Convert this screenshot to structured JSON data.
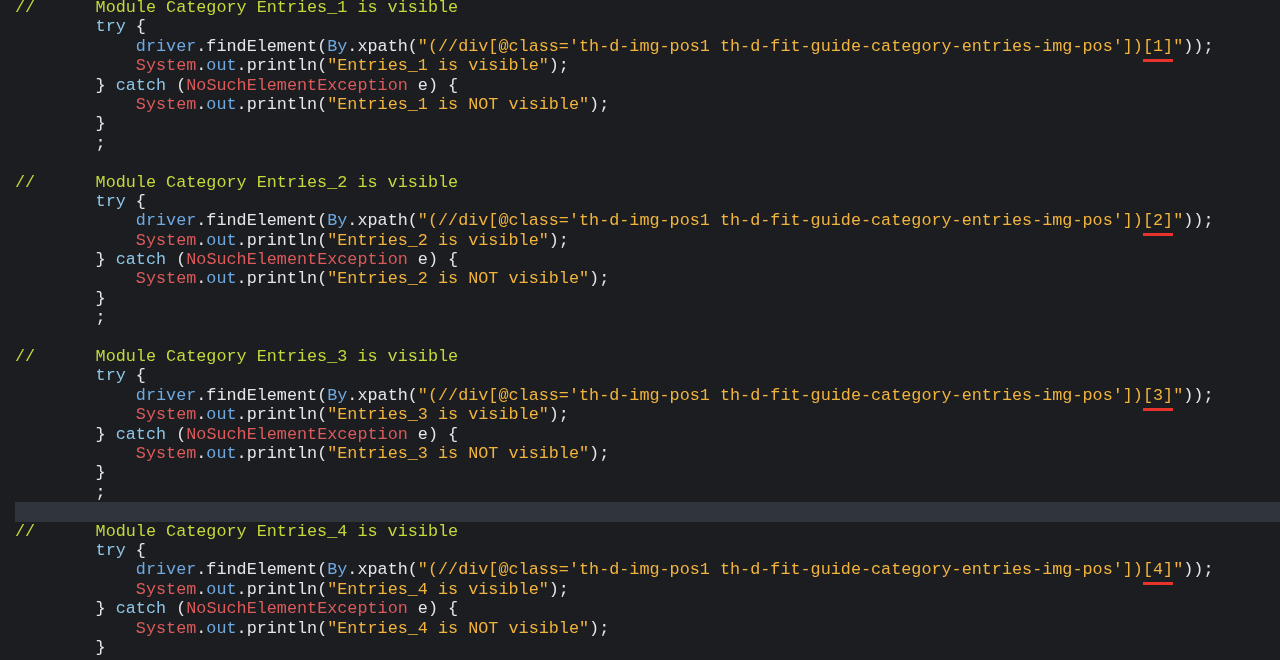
{
  "editor": {
    "lines": [
      {
        "kind": "code",
        "tokens": [
          {
            "kind": "comment",
            "text": "//      Module Category Entries_1 is visible"
          }
        ]
      },
      {
        "kind": "code",
        "tokens": [
          {
            "kind": "keyword",
            "text": "        try"
          },
          {
            "kind": "plain",
            "text": " {"
          }
        ]
      },
      {
        "kind": "code",
        "tokens": [
          {
            "kind": "variable",
            "text": "            driver"
          },
          {
            "kind": "plain",
            "text": ".findElement("
          },
          {
            "kind": "variable",
            "text": "By"
          },
          {
            "kind": "plain",
            "text": ".xpath("
          },
          {
            "kind": "string",
            "text": "\"(//div[@class='th-d-img-pos1 th-d-fit-guide-category-entries-img-pos'])"
          },
          {
            "kind": "underlined_string",
            "text": "[1]"
          },
          {
            "kind": "string",
            "text": "\""
          },
          {
            "kind": "plain",
            "text": "));"
          }
        ]
      },
      {
        "kind": "code",
        "tokens": [
          {
            "kind": "type",
            "text": "            System"
          },
          {
            "kind": "plain",
            "text": "."
          },
          {
            "kind": "variable",
            "text": "out"
          },
          {
            "kind": "plain",
            "text": ".println("
          },
          {
            "kind": "string",
            "text": "\"Entries_1 is visible\""
          },
          {
            "kind": "plain",
            "text": ");"
          }
        ]
      },
      {
        "kind": "code",
        "tokens": [
          {
            "kind": "plain",
            "text": "        } "
          },
          {
            "kind": "keyword",
            "text": "catch"
          },
          {
            "kind": "plain",
            "text": " ("
          },
          {
            "kind": "type",
            "text": "NoSuchElementException"
          },
          {
            "kind": "plain",
            "text": " e) {"
          }
        ]
      },
      {
        "kind": "code",
        "tokens": [
          {
            "kind": "type",
            "text": "            System"
          },
          {
            "kind": "plain",
            "text": "."
          },
          {
            "kind": "variable",
            "text": "out"
          },
          {
            "kind": "plain",
            "text": ".println("
          },
          {
            "kind": "string",
            "text": "\"Entries_1 is NOT visible\""
          },
          {
            "kind": "plain",
            "text": ");"
          }
        ]
      },
      {
        "kind": "code",
        "tokens": [
          {
            "kind": "plain",
            "text": "        }"
          }
        ]
      },
      {
        "kind": "code",
        "tokens": [
          {
            "kind": "plain",
            "text": "        ;"
          }
        ]
      },
      {
        "kind": "blank"
      },
      {
        "kind": "code",
        "tokens": [
          {
            "kind": "comment",
            "text": "//      Module Category Entries_2 is visible"
          }
        ]
      },
      {
        "kind": "code",
        "tokens": [
          {
            "kind": "keyword",
            "text": "        try"
          },
          {
            "kind": "plain",
            "text": " {"
          }
        ]
      },
      {
        "kind": "code",
        "tokens": [
          {
            "kind": "variable",
            "text": "            driver"
          },
          {
            "kind": "plain",
            "text": ".findElement("
          },
          {
            "kind": "variable",
            "text": "By"
          },
          {
            "kind": "plain",
            "text": ".xpath("
          },
          {
            "kind": "string",
            "text": "\"(//div[@class='th-d-img-pos1 th-d-fit-guide-category-entries-img-pos'])"
          },
          {
            "kind": "underlined_string",
            "text": "[2]"
          },
          {
            "kind": "string",
            "text": "\""
          },
          {
            "kind": "plain",
            "text": "));"
          }
        ]
      },
      {
        "kind": "code",
        "tokens": [
          {
            "kind": "type",
            "text": "            System"
          },
          {
            "kind": "plain",
            "text": "."
          },
          {
            "kind": "variable",
            "text": "out"
          },
          {
            "kind": "plain",
            "text": ".println("
          },
          {
            "kind": "string",
            "text": "\"Entries_2 is visible\""
          },
          {
            "kind": "plain",
            "text": ");"
          }
        ]
      },
      {
        "kind": "code",
        "tokens": [
          {
            "kind": "plain",
            "text": "        } "
          },
          {
            "kind": "keyword",
            "text": "catch"
          },
          {
            "kind": "plain",
            "text": " ("
          },
          {
            "kind": "type",
            "text": "NoSuchElementException"
          },
          {
            "kind": "plain",
            "text": " e) {"
          }
        ]
      },
      {
        "kind": "code",
        "tokens": [
          {
            "kind": "type",
            "text": "            System"
          },
          {
            "kind": "plain",
            "text": "."
          },
          {
            "kind": "variable",
            "text": "out"
          },
          {
            "kind": "plain",
            "text": ".println("
          },
          {
            "kind": "string",
            "text": "\"Entries_2 is NOT visible\""
          },
          {
            "kind": "plain",
            "text": ");"
          }
        ]
      },
      {
        "kind": "code",
        "tokens": [
          {
            "kind": "plain",
            "text": "        }"
          }
        ]
      },
      {
        "kind": "code",
        "tokens": [
          {
            "kind": "plain",
            "text": "        ;"
          }
        ]
      },
      {
        "kind": "blank"
      },
      {
        "kind": "code",
        "tokens": [
          {
            "kind": "comment",
            "text": "//      Module Category Entries_3 is visible"
          }
        ]
      },
      {
        "kind": "code",
        "tokens": [
          {
            "kind": "keyword",
            "text": "        try"
          },
          {
            "kind": "plain",
            "text": " {"
          }
        ]
      },
      {
        "kind": "code",
        "tokens": [
          {
            "kind": "variable",
            "text": "            driver"
          },
          {
            "kind": "plain",
            "text": ".findElement("
          },
          {
            "kind": "variable",
            "text": "By"
          },
          {
            "kind": "plain",
            "text": ".xpath("
          },
          {
            "kind": "string",
            "text": "\"(//div[@class='th-d-img-pos1 th-d-fit-guide-category-entries-img-pos'])"
          },
          {
            "kind": "underlined_string",
            "text": "[3]"
          },
          {
            "kind": "string",
            "text": "\""
          },
          {
            "kind": "plain",
            "text": "));"
          }
        ]
      },
      {
        "kind": "code",
        "tokens": [
          {
            "kind": "type",
            "text": "            System"
          },
          {
            "kind": "plain",
            "text": "."
          },
          {
            "kind": "variable",
            "text": "out"
          },
          {
            "kind": "plain",
            "text": ".println("
          },
          {
            "kind": "string",
            "text": "\"Entries_3 is visible\""
          },
          {
            "kind": "plain",
            "text": ");"
          }
        ]
      },
      {
        "kind": "code",
        "tokens": [
          {
            "kind": "plain",
            "text": "        } "
          },
          {
            "kind": "keyword",
            "text": "catch"
          },
          {
            "kind": "plain",
            "text": " ("
          },
          {
            "kind": "type",
            "text": "NoSuchElementException"
          },
          {
            "kind": "plain",
            "text": " e) {"
          }
        ]
      },
      {
        "kind": "code",
        "tokens": [
          {
            "kind": "type",
            "text": "            System"
          },
          {
            "kind": "plain",
            "text": "."
          },
          {
            "kind": "variable",
            "text": "out"
          },
          {
            "kind": "plain",
            "text": ".println("
          },
          {
            "kind": "string",
            "text": "\"Entries_3 is NOT visible\""
          },
          {
            "kind": "plain",
            "text": ");"
          }
        ]
      },
      {
        "kind": "code",
        "tokens": [
          {
            "kind": "plain",
            "text": "        }"
          }
        ]
      },
      {
        "kind": "code",
        "tokens": [
          {
            "kind": "plain",
            "text": "        ;"
          }
        ]
      },
      {
        "kind": "current_line"
      },
      {
        "kind": "code",
        "tokens": [
          {
            "kind": "comment",
            "text": "//      Module Category Entries_4 is visible"
          }
        ]
      },
      {
        "kind": "code",
        "tokens": [
          {
            "kind": "keyword",
            "text": "        try"
          },
          {
            "kind": "plain",
            "text": " {"
          }
        ]
      },
      {
        "kind": "code",
        "tokens": [
          {
            "kind": "variable",
            "text": "            driver"
          },
          {
            "kind": "plain",
            "text": ".findElement("
          },
          {
            "kind": "variable",
            "text": "By"
          },
          {
            "kind": "plain",
            "text": ".xpath("
          },
          {
            "kind": "string",
            "text": "\"(//div[@class='th-d-img-pos1 th-d-fit-guide-category-entries-img-pos'])"
          },
          {
            "kind": "underlined_string",
            "text": "[4]"
          },
          {
            "kind": "string",
            "text": "\""
          },
          {
            "kind": "plain",
            "text": "));"
          }
        ]
      },
      {
        "kind": "code",
        "tokens": [
          {
            "kind": "type",
            "text": "            System"
          },
          {
            "kind": "plain",
            "text": "."
          },
          {
            "kind": "variable",
            "text": "out"
          },
          {
            "kind": "plain",
            "text": ".println("
          },
          {
            "kind": "string",
            "text": "\"Entries_4 is visible\""
          },
          {
            "kind": "plain",
            "text": ");"
          }
        ]
      },
      {
        "kind": "code",
        "tokens": [
          {
            "kind": "plain",
            "text": "        } "
          },
          {
            "kind": "keyword",
            "text": "catch"
          },
          {
            "kind": "plain",
            "text": " ("
          },
          {
            "kind": "type",
            "text": "NoSuchElementException"
          },
          {
            "kind": "plain",
            "text": " e) {"
          }
        ]
      },
      {
        "kind": "code",
        "tokens": [
          {
            "kind": "type",
            "text": "            System"
          },
          {
            "kind": "plain",
            "text": "."
          },
          {
            "kind": "variable",
            "text": "out"
          },
          {
            "kind": "plain",
            "text": ".println("
          },
          {
            "kind": "string",
            "text": "\"Entries_4 is NOT visible\""
          },
          {
            "kind": "plain",
            "text": ");"
          }
        ]
      },
      {
        "kind": "code",
        "tokens": [
          {
            "kind": "plain",
            "text": "        }"
          }
        ]
      }
    ]
  }
}
